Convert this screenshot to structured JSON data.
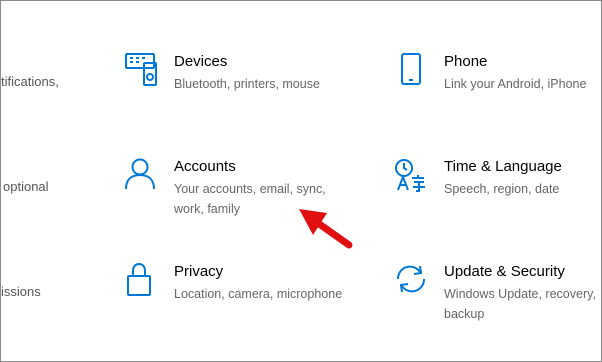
{
  "left_cut": {
    "row1": "tifications,",
    "row2": "optional",
    "row3": "issions"
  },
  "tiles": [
    {
      "title": "Devices",
      "desc": "Bluetooth, printers, mouse",
      "icon": "devices-icon"
    },
    {
      "title": "Phone",
      "desc": "Link your Android, iPhone",
      "icon": "phone-icon"
    },
    {
      "title": "Accounts",
      "desc": "Your accounts, email, sync, work, family",
      "icon": "accounts-icon"
    },
    {
      "title": "Time & Language",
      "desc": "Speech, region, date",
      "icon": "time-language-icon"
    },
    {
      "title": "Privacy",
      "desc": "Location, camera, microphone",
      "icon": "privacy-icon"
    },
    {
      "title": "Update & Security",
      "desc": "Windows Update, recovery, backup",
      "icon": "update-security-icon"
    }
  ],
  "colors": {
    "accent": "#0078d7",
    "annotation_arrow": "#e01010"
  }
}
